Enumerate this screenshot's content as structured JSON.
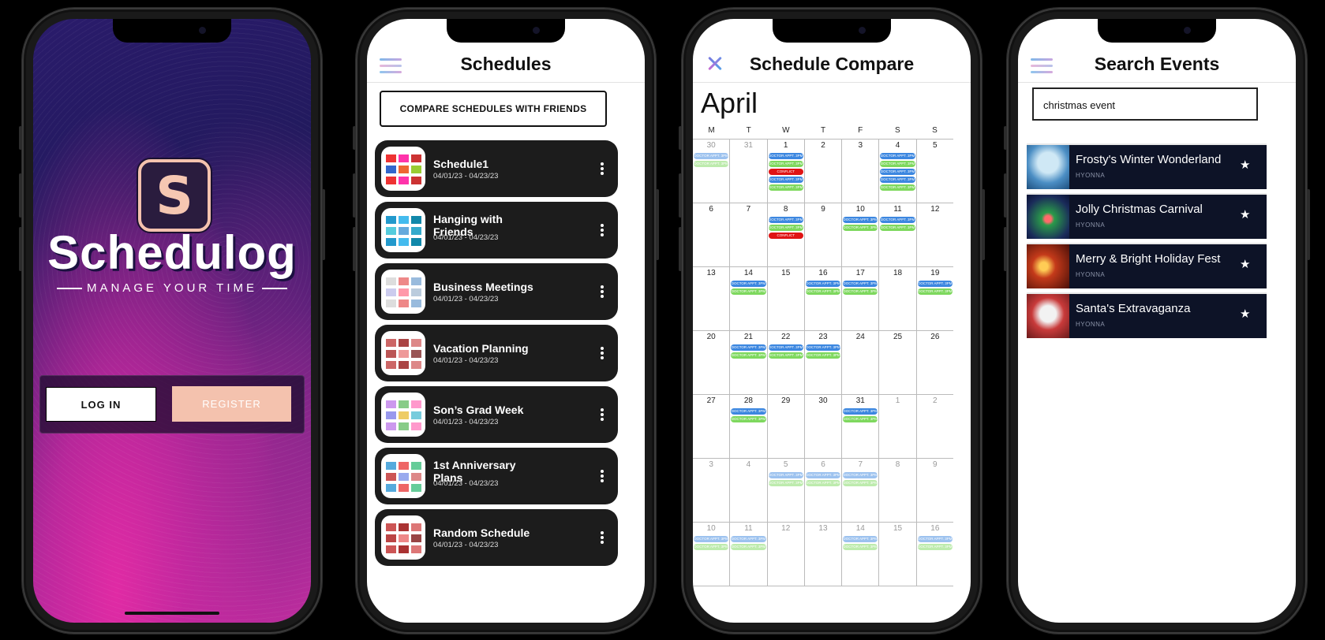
{
  "phone1": {
    "logo_letter": "S",
    "app_name": "Schedulog",
    "tagline": "MANAGE YOUR TIME",
    "login_label": "LOG IN",
    "register_label": "REGISTER"
  },
  "phone2": {
    "title": "Schedules",
    "compare_label": "COMPARE SCHEDULES WITH FRIENDS",
    "schedules": [
      {
        "name": "Schedule1",
        "date": "04/01/23 - 04/23/23"
      },
      {
        "name": "Hanging with Friends",
        "date": "04/01/23 - 04/23/23"
      },
      {
        "name": "Business Meetings",
        "date": "04/01/23 - 04/23/23"
      },
      {
        "name": "Vacation Planning",
        "date": "04/01/23 - 04/23/23"
      },
      {
        "name": "Son’s Grad Week",
        "date": "04/01/23 - 04/23/23"
      },
      {
        "name": "1st Anniversary Plans",
        "date": "04/01/23 - 04/23/23"
      },
      {
        "name": "Random Schedule",
        "date": "04/01/23 - 04/23/23"
      }
    ]
  },
  "phone3": {
    "title": "Schedule Compare",
    "month": "April",
    "weekdays": [
      "M",
      "T",
      "W",
      "T",
      "F",
      "S",
      "S"
    ],
    "event_labels": {
      "doctor": "DOCTOR APPT. 3PM",
      "conflict": "CONFLICT"
    },
    "weeks": [
      [
        {
          "d": "30",
          "out": true,
          "ev": [
            "b",
            "g"
          ]
        },
        {
          "d": "31",
          "out": true,
          "ev": []
        },
        {
          "d": "1",
          "ev": [
            "b",
            "g",
            "r",
            "b",
            "g"
          ]
        },
        {
          "d": "2",
          "ev": []
        },
        {
          "d": "3",
          "ev": []
        },
        {
          "d": "4",
          "ev": [
            "b",
            "g",
            "b",
            "b",
            "g"
          ]
        },
        {
          "d": "5",
          "ev": []
        }
      ],
      [
        {
          "d": "6",
          "ev": []
        },
        {
          "d": "7",
          "ev": []
        },
        {
          "d": "8",
          "ev": [
            "b",
            "g",
            "r"
          ]
        },
        {
          "d": "9",
          "ev": []
        },
        {
          "d": "10",
          "ev": [
            "b",
            "g"
          ]
        },
        {
          "d": "11",
          "ev": [
            "b",
            "g"
          ]
        },
        {
          "d": "12",
          "ev": []
        }
      ],
      [
        {
          "d": "13",
          "ev": []
        },
        {
          "d": "14",
          "ev": [
            "b",
            "g"
          ]
        },
        {
          "d": "15",
          "ev": []
        },
        {
          "d": "16",
          "ev": [
            "b",
            "g"
          ]
        },
        {
          "d": "17",
          "ev": [
            "b",
            "g"
          ]
        },
        {
          "d": "18",
          "ev": []
        },
        {
          "d": "19",
          "ev": [
            "b",
            "g"
          ]
        }
      ],
      [
        {
          "d": "20",
          "ev": []
        },
        {
          "d": "21",
          "ev": [
            "b",
            "g"
          ]
        },
        {
          "d": "22",
          "ev": [
            "b",
            "g"
          ]
        },
        {
          "d": "23",
          "ev": [
            "b",
            "g"
          ]
        },
        {
          "d": "24",
          "ev": []
        },
        {
          "d": "25",
          "ev": []
        },
        {
          "d": "26",
          "ev": []
        }
      ],
      [
        {
          "d": "27",
          "ev": []
        },
        {
          "d": "28",
          "ev": [
            "b",
            "g"
          ]
        },
        {
          "d": "29",
          "ev": []
        },
        {
          "d": "30",
          "ev": []
        },
        {
          "d": "31",
          "ev": [
            "b",
            "g"
          ]
        },
        {
          "d": "1",
          "out": true,
          "ev": []
        },
        {
          "d": "2",
          "out": true,
          "ev": []
        }
      ],
      [
        {
          "d": "3",
          "out": true,
          "ev": []
        },
        {
          "d": "4",
          "out": true,
          "ev": []
        },
        {
          "d": "5",
          "out": true,
          "ev": [
            "b",
            "g"
          ]
        },
        {
          "d": "6",
          "out": true,
          "ev": [
            "b",
            "g"
          ]
        },
        {
          "d": "7",
          "out": true,
          "ev": [
            "b",
            "g"
          ]
        },
        {
          "d": "8",
          "out": true,
          "ev": []
        },
        {
          "d": "9",
          "out": true,
          "ev": []
        }
      ],
      [
        {
          "d": "10",
          "out": true,
          "ev": [
            "b",
            "g"
          ]
        },
        {
          "d": "11",
          "out": true,
          "ev": [
            "b",
            "g"
          ]
        },
        {
          "d": "12",
          "out": true,
          "ev": []
        },
        {
          "d": "13",
          "out": true,
          "ev": []
        },
        {
          "d": "14",
          "out": true,
          "ev": [
            "b",
            "g"
          ]
        },
        {
          "d": "15",
          "out": true,
          "ev": []
        },
        {
          "d": "16",
          "out": true,
          "ev": [
            "b",
            "g"
          ]
        }
      ]
    ]
  },
  "phone4": {
    "title": "Search Events",
    "search_value": "christmas event",
    "results": [
      {
        "title": "Frosty's Winter Wonderland",
        "host": "HYONNA"
      },
      {
        "title": "Jolly Christmas Carnival",
        "host": "HYONNA"
      },
      {
        "title": "Merry & Bright Holiday Fest",
        "host": "HYONNA"
      },
      {
        "title": "Santa's Extravaganza",
        "host": "HYONNA"
      }
    ]
  },
  "colors": {
    "accent_peach": "#f4c2ae",
    "card_dark": "#1c1c1c",
    "event_row_navy": "#0d1327",
    "event_blue": "#3c87e0",
    "event_green": "#7ed85e",
    "event_conflict": "#e01414"
  }
}
